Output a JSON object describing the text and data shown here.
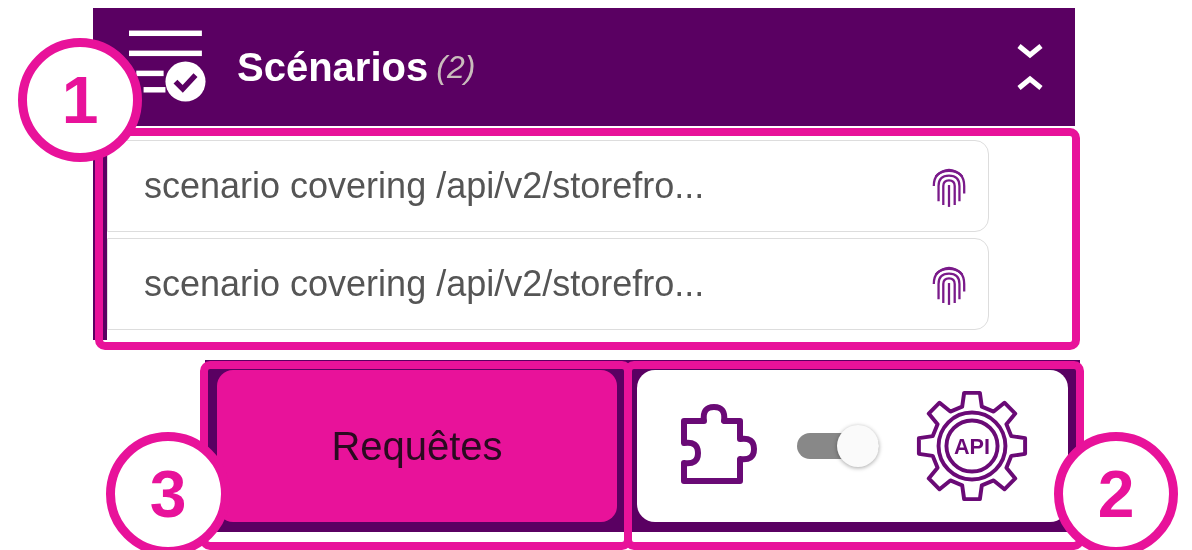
{
  "panel": {
    "title": "Scénarios",
    "count": "(2)",
    "expanded": true
  },
  "scenarios": [
    {
      "label": "scenario covering /api/v2/storefro..."
    },
    {
      "label": "scenario covering /api/v2/storefro..."
    }
  ],
  "requests_button": {
    "label": "Requêtes"
  },
  "mode_switch": {
    "on": true,
    "api_label": "API"
  },
  "callouts": [
    {
      "number": "1"
    },
    {
      "number": "3"
    },
    {
      "number": "2"
    }
  ]
}
